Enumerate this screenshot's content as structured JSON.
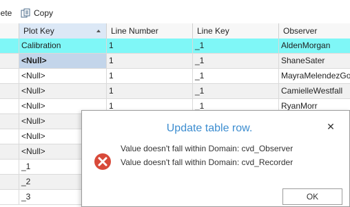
{
  "toolbar": {
    "delete_label": "lete",
    "copy_label": "Copy",
    "copy_icon": "copy-icon"
  },
  "table": {
    "columns": [
      {
        "label": ""
      },
      {
        "label": "Plot Key",
        "sorted": "ascending"
      },
      {
        "label": "Line Number"
      },
      {
        "label": "Line Key"
      },
      {
        "label": "Observer"
      }
    ],
    "rows": [
      {
        "plot_key": "Calibration",
        "line_number": "1",
        "line_key": "_1",
        "observer": "AldenMorgan",
        "selected": true
      },
      {
        "plot_key": "<Null>",
        "line_number": "1",
        "line_key": "_1",
        "observer": "ShaneSater",
        "editing": true
      },
      {
        "plot_key": "<Null>",
        "line_number": "1",
        "line_key": "_1",
        "observer": "MayraMelendezGo"
      },
      {
        "plot_key": "<Null>",
        "line_number": "1",
        "line_key": "_1",
        "observer": "CamielleWestfall"
      },
      {
        "plot_key": "<Null>",
        "line_number": "1",
        "line_key": "_1",
        "observer": "RyanMorr"
      },
      {
        "plot_key": "<Null>",
        "line_number": "",
        "line_key": "",
        "observer": ""
      },
      {
        "plot_key": "<Null>",
        "line_number": "",
        "line_key": "",
        "observer": ""
      },
      {
        "plot_key": "<Null>",
        "line_number": "",
        "line_key": "",
        "observer": ""
      },
      {
        "plot_key": "_1",
        "line_number": "",
        "line_key": "",
        "observer": ""
      },
      {
        "plot_key": "_2",
        "line_number": "",
        "line_key": "",
        "observer": ""
      },
      {
        "plot_key": "_3",
        "line_number": "",
        "line_key": "",
        "observer": ""
      }
    ]
  },
  "dialog": {
    "title": "Update table row.",
    "close_icon": "close-icon",
    "error_icon": "error-icon",
    "messages": [
      "Value doesn't fall within Domain: cvd_Observer",
      "Value doesn't fall within Domain: cvd_Recorder"
    ],
    "ok_label": "OK"
  },
  "colors": {
    "selected_row": "#7ff7f7",
    "editing_cell": "#c3d5ea",
    "dialog_title": "#3c8dd0",
    "error_icon": "#d84a3a"
  }
}
